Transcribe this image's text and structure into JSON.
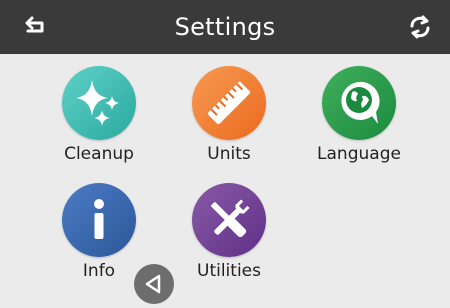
{
  "header": {
    "title": "Settings",
    "back_icon": "back-arrow-icon",
    "refresh_icon": "refresh-icon"
  },
  "tiles": [
    {
      "label": "Cleanup",
      "icon": "sparkle-icon",
      "color": "#2aa99f"
    },
    {
      "label": "Units",
      "icon": "ruler-icon",
      "color": "#ea6a1e"
    },
    {
      "label": "Language",
      "icon": "globe-speech-icon",
      "color": "#1b8a3e"
    },
    {
      "label": "Info",
      "icon": "info-icon",
      "color": "#2c5699"
    },
    {
      "label": "Utilities",
      "icon": "tools-icon",
      "color": "#5f2f86"
    }
  ],
  "nav": {
    "previous_icon": "triangle-left-icon"
  },
  "colors": {
    "header_bg": "#3a3a3a",
    "screen_bg": "#ebebeb"
  }
}
